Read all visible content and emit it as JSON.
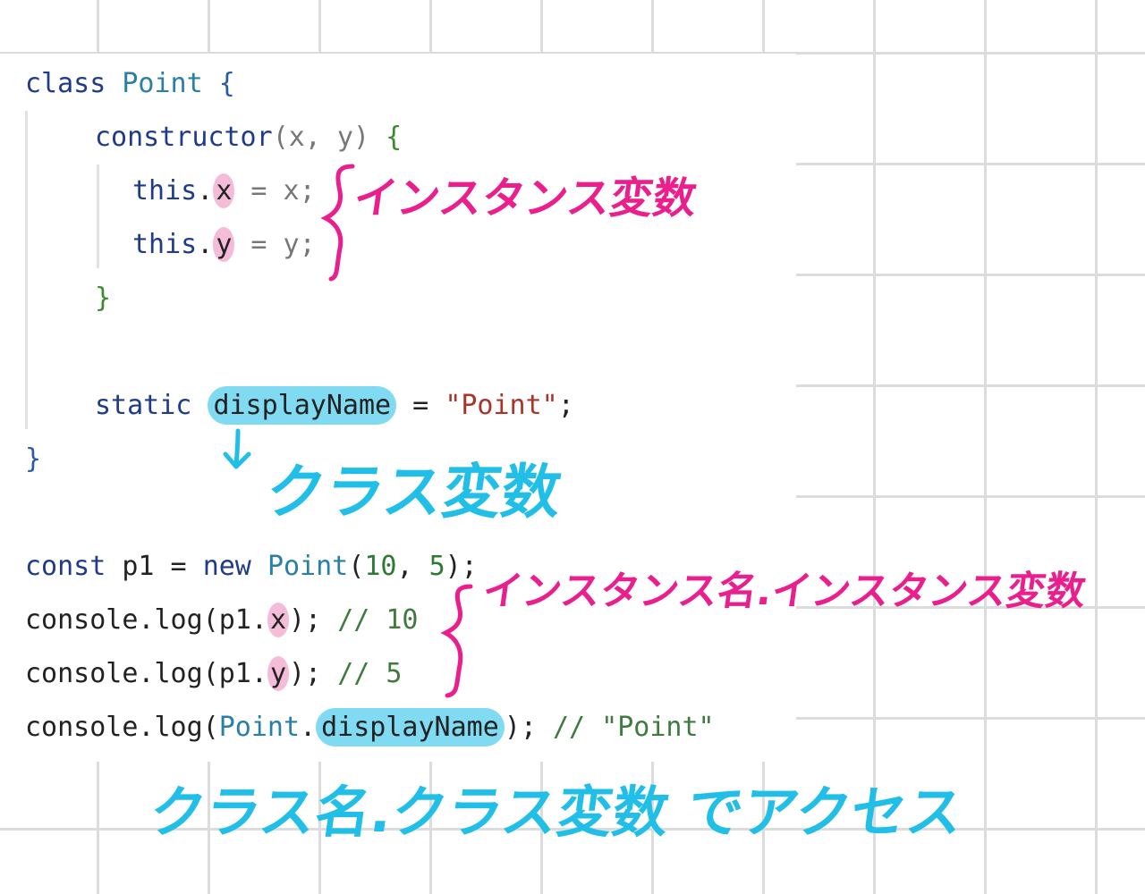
{
  "code": {
    "line1": {
      "kw": "class",
      "name": "Point",
      "brace": "{"
    },
    "line2": {
      "kw": "constructor",
      "params": "(x, y)",
      "brace": "{"
    },
    "line3": {
      "this": "this",
      "dot": ".",
      "prop": "x",
      "rest": " = x;"
    },
    "line4": {
      "this": "this",
      "dot": ".",
      "prop": "y",
      "rest": " = y;"
    },
    "line5": {
      "brace": "}"
    },
    "line6": {
      "kw": "static",
      "prop": "displayName",
      "eq": " = ",
      "str": "\"Point\"",
      "semi": ";"
    },
    "line7": {
      "brace": "}"
    },
    "line8": {
      "kw1": "const",
      "var": " p1 = ",
      "kw2": "new",
      "cls": "Point",
      "open": "(",
      "n1": "10",
      "comma": ", ",
      "n2": "5",
      "close": ");"
    },
    "line9": {
      "call": "console.log(p1",
      "dot": ".",
      "prop": "x",
      "close": ");",
      "comment": "// 10"
    },
    "line10": {
      "call": "console.log(p1",
      "dot": ".",
      "prop": "y",
      "close": ");",
      "comment": "// 5"
    },
    "line11": {
      "call": "console.log(",
      "cls": "Point",
      "dot": ".",
      "prop": "displayName",
      "close": ");",
      "comment": "// \"Point\""
    }
  },
  "annotations": {
    "instance_variable": "インスタンス変数",
    "class_variable": "クラス変数",
    "instance_access": "インスタンス名.インスタンス変数",
    "class_access": "クラス名.クラス変数 でアクセス"
  },
  "colors": {
    "pink": "#ea1e8c",
    "cyan": "#21bfe8",
    "pink_highlight": "#f5bcd9",
    "cyan_highlight": "#7fdaf2"
  }
}
